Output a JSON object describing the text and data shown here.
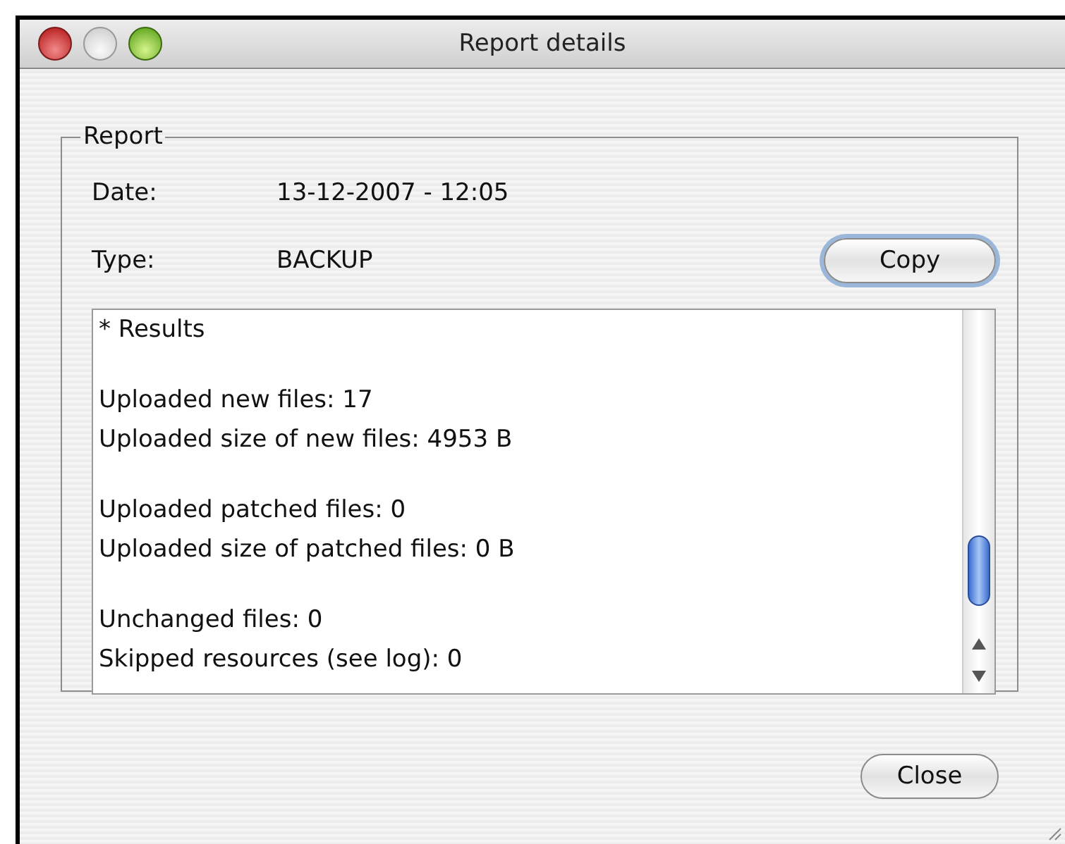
{
  "window": {
    "title": "Report details"
  },
  "report": {
    "legend": "Report",
    "fields": [
      {
        "label": "Date:",
        "value": "13-12-2007 - 12:05"
      },
      {
        "label": "Type:",
        "value": "BACKUP"
      }
    ],
    "copy_button": {
      "label": "Copy",
      "focused": true
    },
    "results": {
      "paragraphs": [
        [
          "* Results"
        ],
        [
          "Uploaded new files: 17",
          "Uploaded size of new files: 4953 B"
        ],
        [
          "Uploaded patched files: 0",
          "Uploaded size of patched files: 0 B"
        ],
        [
          "Unchanged files: 0",
          "Skipped resources (see log): 0"
        ]
      ]
    }
  },
  "close_button": {
    "label": "Close",
    "focused": false
  }
}
